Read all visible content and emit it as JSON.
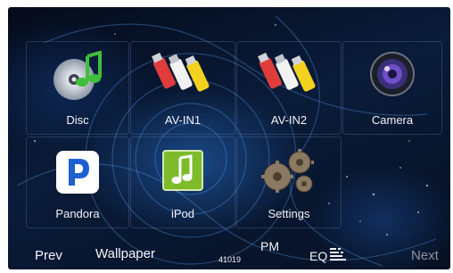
{
  "apps": [
    {
      "label": "Disc",
      "icon": "disc-music-icon"
    },
    {
      "label": "AV-IN1",
      "icon": "rca-cables-icon"
    },
    {
      "label": "AV-IN2",
      "icon": "rca-cables-icon"
    },
    {
      "label": "Camera",
      "icon": "camera-lens-icon"
    },
    {
      "label": "Pandora",
      "icon": "pandora-icon"
    },
    {
      "label": "iPod",
      "icon": "ipod-music-note-icon"
    },
    {
      "label": "Settings",
      "icon": "gears-icon"
    }
  ],
  "bottom_bar": {
    "prev_label": "Prev",
    "wallpaper_label": "Wallpaper",
    "code_label": "41019",
    "period_label": "PM",
    "eq_label": "EQ",
    "next_label": "Next"
  },
  "colors": {
    "background": "#07142b",
    "text": "#f2f4f8",
    "next_disabled": "#8b93a3"
  }
}
